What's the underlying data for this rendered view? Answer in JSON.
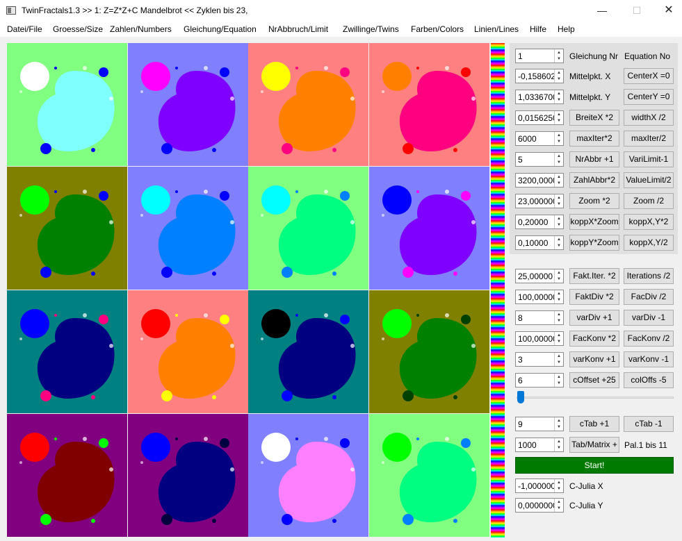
{
  "window": {
    "title": "TwinFractals1.3 >> 1: Z=Z*Z+C Mandelbrot << Zyklen bis 23,",
    "minimize_glyph": "—",
    "maximize_glyph": "☐",
    "close_glyph": "✕"
  },
  "menu": [
    "Datei/File",
    "Groesse/Size",
    "Zahlen/Numbers",
    "Gleichung/Equation",
    "NrAbbruch/Limit",
    "Zwillinge/Twins",
    "Farben/Colors",
    "Linien/Lines",
    "Hilfe",
    "Help"
  ],
  "tiles": [
    {
      "bg": "#80ff80",
      "body": "#80ffff",
      "bulb": "#ffffff",
      "dot": "#0000ff"
    },
    {
      "bg": "#8080ff",
      "body": "#8000ff",
      "bulb": "#ff00ff",
      "dot": "#0000ff"
    },
    {
      "bg": "#ff8080",
      "body": "#ff8000",
      "bulb": "#ffff00",
      "dot": "#ff0080"
    },
    {
      "bg": "#ff8080",
      "body": "#ff0080",
      "bulb": "#ff8000",
      "dot": "#ff0000"
    },
    {
      "bg": "#808000",
      "body": "#008000",
      "bulb": "#00ff00",
      "dot": "#0000ff"
    },
    {
      "bg": "#8080ff",
      "body": "#0080ff",
      "bulb": "#00ffff",
      "dot": "#0000ff"
    },
    {
      "bg": "#80ff80",
      "body": "#00ff80",
      "bulb": "#00ffff",
      "dot": "#0080ff"
    },
    {
      "bg": "#8080ff",
      "body": "#8000ff",
      "bulb": "#0000ff",
      "dot": "#ff00ff"
    },
    {
      "bg": "#008080",
      "body": "#000080",
      "bulb": "#0000ff",
      "dot": "#ff0080"
    },
    {
      "bg": "#ff8080",
      "body": "#ff8000",
      "bulb": "#ff0000",
      "dot": "#ffff00"
    },
    {
      "bg": "#008080",
      "body": "#000080",
      "bulb": "#000000",
      "dot": "#0000ff"
    },
    {
      "bg": "#808000",
      "body": "#008000",
      "bulb": "#00ff00",
      "dot": "#004000"
    },
    {
      "bg": "#800080",
      "body": "#800000",
      "bulb": "#ff0000",
      "dot": "#00ff00"
    },
    {
      "bg": "#800080",
      "body": "#000080",
      "bulb": "#0000ff",
      "dot": "#000040"
    },
    {
      "bg": "#8080ff",
      "body": "#ff80ff",
      "bulb": "#ffffff",
      "dot": "#0000ff"
    },
    {
      "bg": "#80ff80",
      "body": "#00ff80",
      "bulb": "#00ff00",
      "dot": "#0080ff"
    }
  ],
  "controls": {
    "equation_nr": {
      "value": "1",
      "label": "Gleichung Nr",
      "label2": "Equation No"
    },
    "center_x": {
      "value": "-0,158602(",
      "label": "Mittelpkt. X",
      "button": "CenterX =0"
    },
    "center_y": {
      "value": "1,0336700",
      "label": "Mittelpkt. Y",
      "button": "CenterY =0"
    },
    "width": {
      "value": "0,0156250",
      "button1": "BreiteX *2",
      "button2": "widthX /2"
    },
    "max_iter": {
      "value": "6000",
      "button1": "maxIter*2",
      "button2": "maxIter/2"
    },
    "nr_abbr": {
      "value": "5",
      "button1": "NrAbbr +1",
      "button2": "VariLimit-1"
    },
    "zahl_abbr": {
      "value": "3200,0000",
      "button1": "ZahlAbbr*2",
      "button2": "ValueLimit/2"
    },
    "zoom": {
      "value": "23,000000",
      "button1": "Zoom *2",
      "button2": "Zoom /2"
    },
    "kopp_x": {
      "value": "0,20000",
      "button1": "koppX*Zoom",
      "button2": "koppX,Y*2"
    },
    "kopp_y": {
      "value": "0,10000",
      "button1": "koppY*Zoom",
      "button2": "koppX,Y/2"
    },
    "fakt_iter": {
      "value": "25,00000",
      "button1": "Fakt.Iter. *2",
      "button2": "Iterations /2"
    },
    "fakt_div": {
      "value": "100,00000",
      "button1": "FaktDiv *2",
      "button2": "FacDiv /2"
    },
    "var_div": {
      "value": "8",
      "button1": "varDiv +1",
      "button2": "varDiv -1"
    },
    "fac_konv": {
      "value": "100,00000",
      "button1": "FacKonv *2",
      "button2": "FacKonv /2"
    },
    "var_konv": {
      "value": "3",
      "button1": "varKonv +1",
      "button2": "varKonv -1"
    },
    "c_offset": {
      "value": "6",
      "button1": "cOffset +25",
      "button2": "colOffs -5"
    },
    "ctab": {
      "value": "9",
      "button1": "cTab +1",
      "button2": "cTab -1"
    },
    "tab_matrix": {
      "value": "1000",
      "button1": "Tab/Matrix +",
      "label": "Pal.1 bis 11"
    },
    "start_label": "Start!",
    "c_julia_x": {
      "value": "-1,000000(",
      "label": "C-Julia X"
    },
    "c_julia_y": {
      "value": "0,0000000",
      "label": "C-Julia Y"
    },
    "spin_up_glyph": "▲",
    "spin_down_glyph": "▼"
  },
  "colors": {
    "accent": "#0078d7",
    "start_button": "#007a00"
  }
}
